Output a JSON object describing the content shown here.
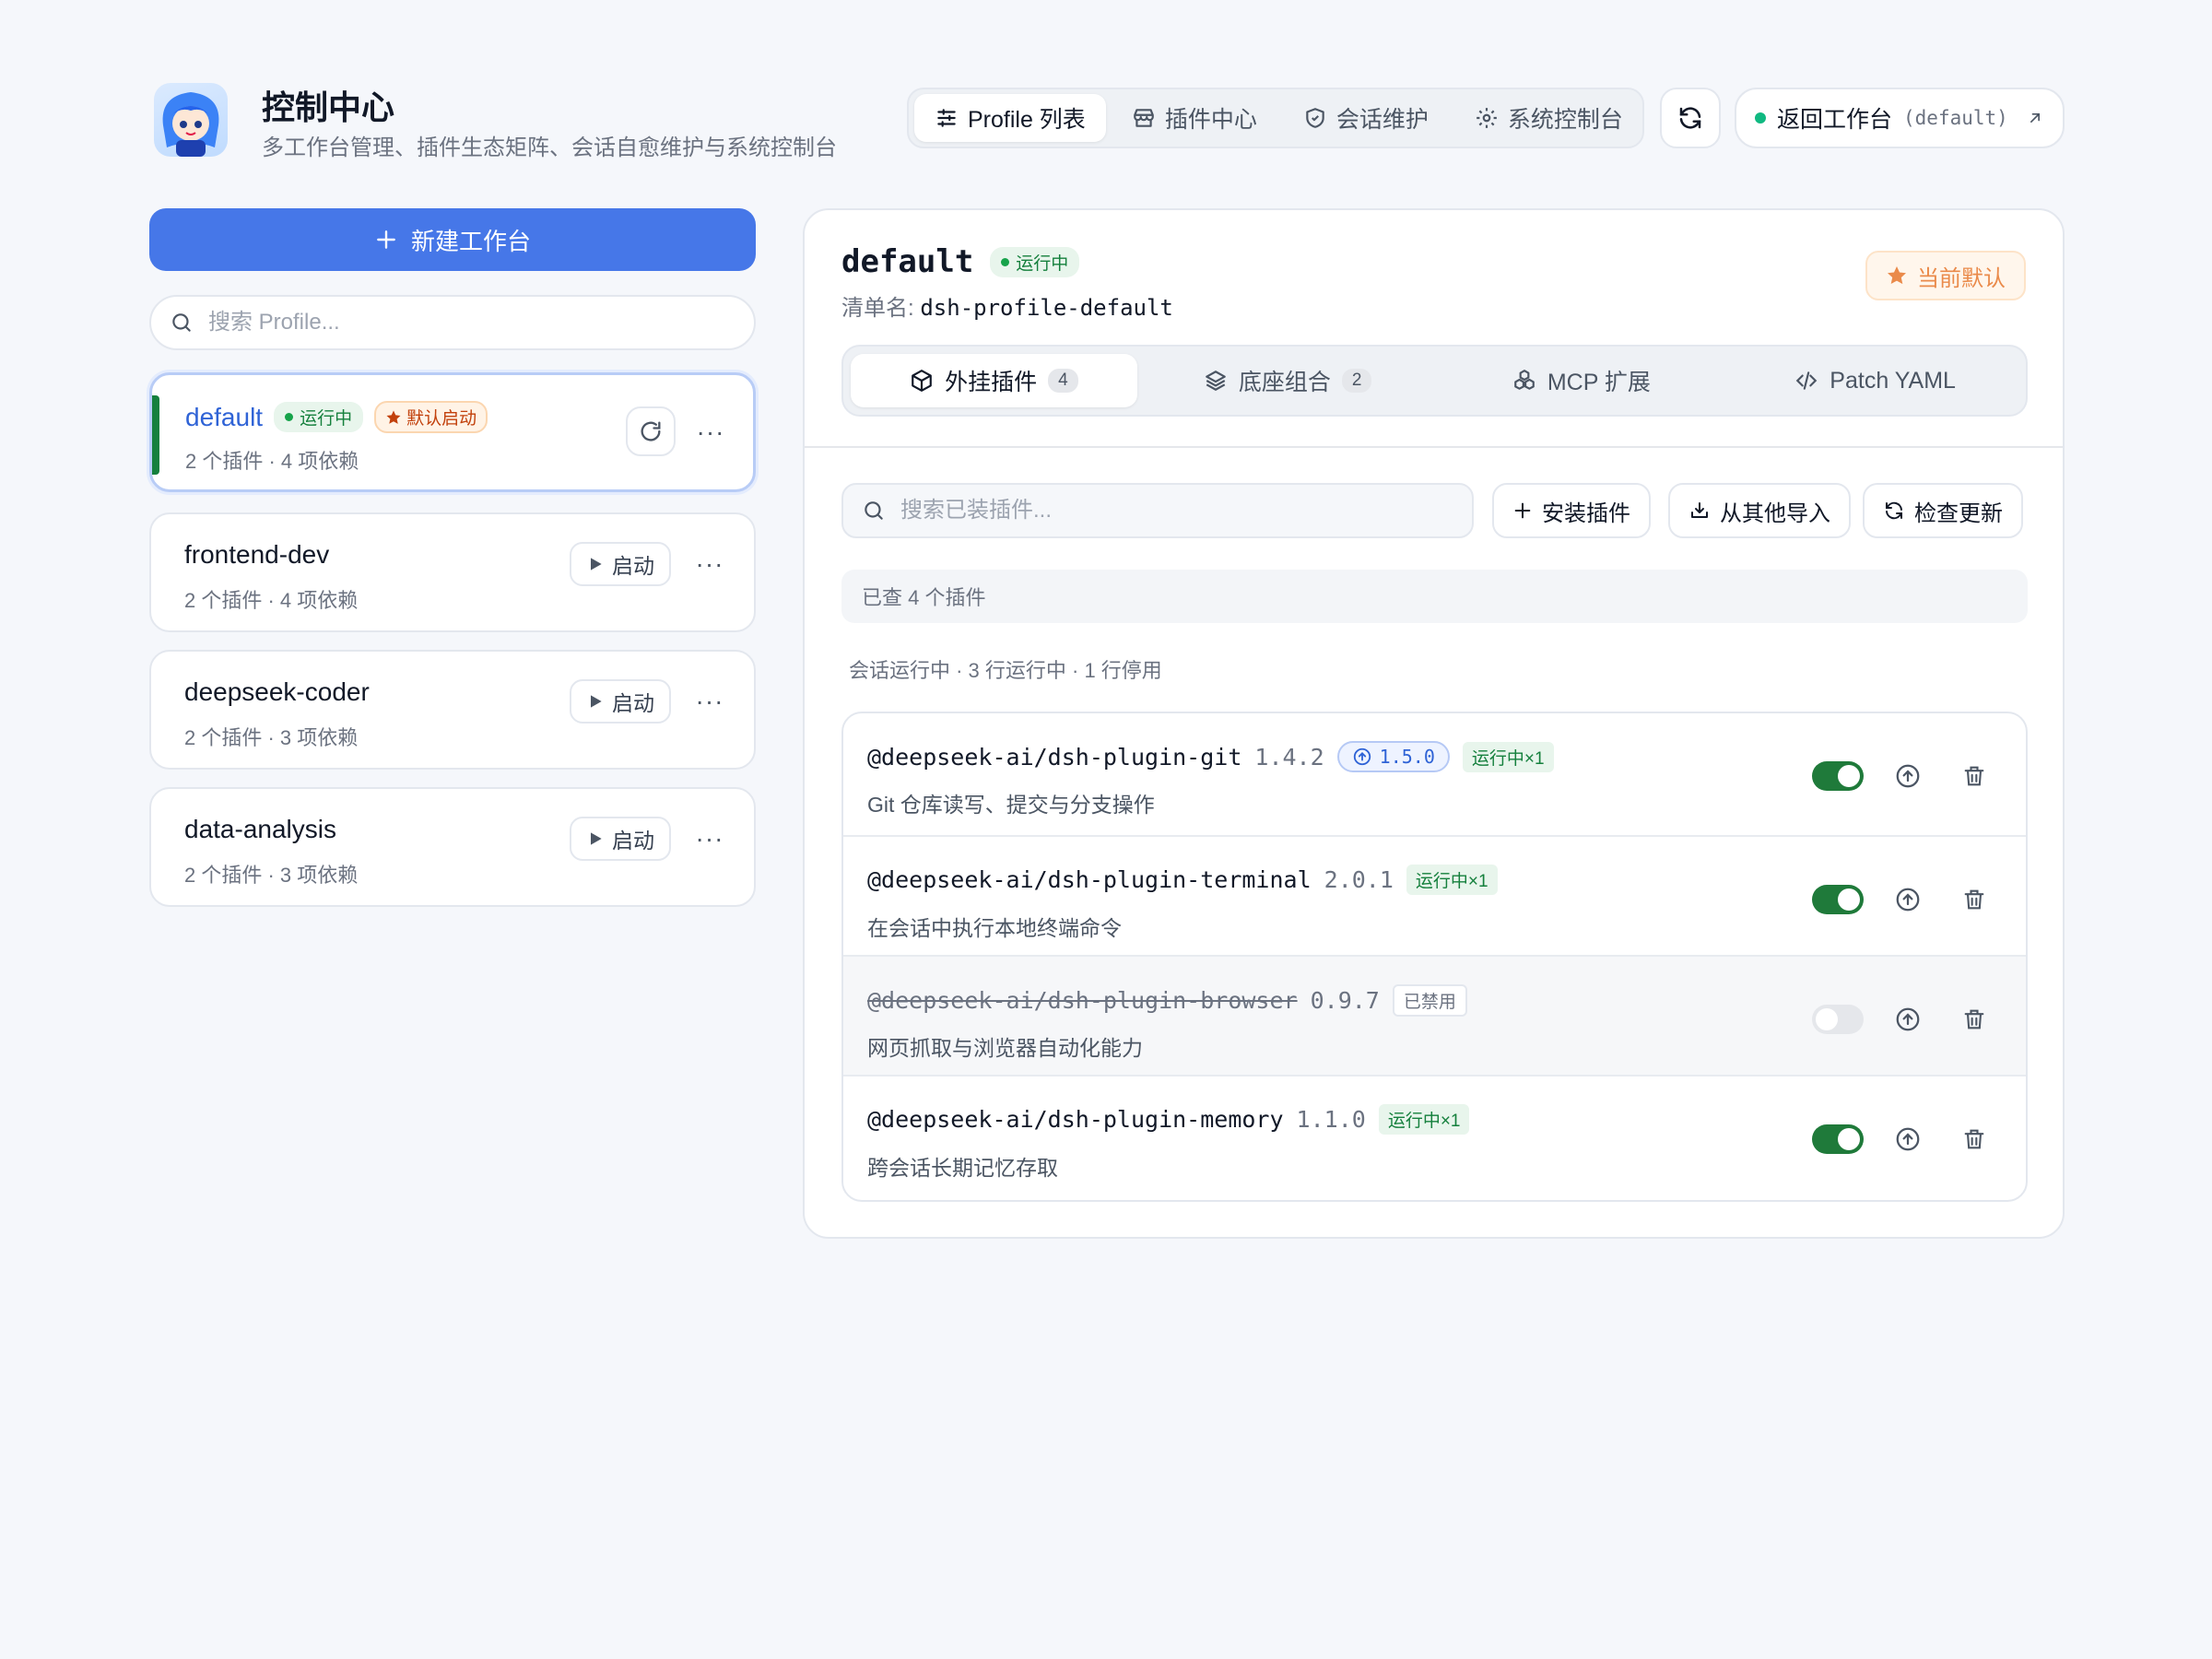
{
  "header": {
    "title": "控制中心",
    "subtitle": "多工作台管理、插件生态矩阵、会话自愈维护与系统控制台",
    "nav": [
      {
        "label": "Profile 列表",
        "icon": "sliders-icon"
      },
      {
        "label": "插件中心",
        "icon": "store-icon"
      },
      {
        "label": "会话维护",
        "icon": "shield-icon"
      },
      {
        "label": "系统控制台",
        "icon": "gear-icon"
      }
    ],
    "back_label": "返回工作台",
    "back_profile": "(default)"
  },
  "sidebar": {
    "new_button": "新建工作台",
    "search_placeholder": "搜索 Profile...",
    "profiles": [
      {
        "name": "default",
        "status": "运行中",
        "default_badge": "默认启动",
        "meta": "2 个插件 · 4 项依赖"
      },
      {
        "name": "frontend-dev",
        "meta": "2 个插件 · 4 项依赖",
        "start_label": "启动"
      },
      {
        "name": "deepseek-coder",
        "meta": "2 个插件 · 3 项依赖",
        "start_label": "启动"
      },
      {
        "name": "data-analysis",
        "meta": "2 个插件 · 3 项依赖",
        "start_label": "启动"
      }
    ]
  },
  "detail": {
    "name": "default",
    "status": "运行中",
    "manifest_label": "清单名:",
    "manifest_value": "dsh-profile-default",
    "current_default": "当前默认",
    "tabs": [
      {
        "label": "外挂插件",
        "count": "4"
      },
      {
        "label": "底座组合",
        "count": "2"
      },
      {
        "label": "MCP 扩展"
      },
      {
        "label": "Patch YAML"
      }
    ],
    "search_placeholder": "搜索已装插件...",
    "actions": {
      "install": "安装插件",
      "import": "从其他导入",
      "check": "检查更新"
    },
    "found_text": "已查 4 个插件",
    "summary": "会话运行中 · 3 行运行中 · 1 行停用",
    "plugins": [
      {
        "name": "@deepseek-ai/dsh-plugin-git",
        "version": "1.4.2",
        "update": "1.5.0",
        "badge": "运行中×1",
        "desc": "Git 仓库读写、提交与分支操作",
        "enabled": true
      },
      {
        "name": "@deepseek-ai/dsh-plugin-terminal",
        "version": "2.0.1",
        "badge": "运行中×1",
        "desc": "在会话中执行本地终端命令",
        "enabled": true
      },
      {
        "name": "@deepseek-ai/dsh-plugin-browser",
        "version": "0.9.7",
        "badge": "已禁用",
        "desc": "网页抓取与浏览器自动化能力",
        "enabled": false
      },
      {
        "name": "@deepseek-ai/dsh-plugin-memory",
        "version": "1.1.0",
        "badge": "运行中×1",
        "desc": "跨会话长期记忆存取",
        "enabled": true
      }
    ]
  },
  "colors": {
    "accent": "#4677e8",
    "running": "#15803d",
    "toggle_on": "#1f7a3a",
    "default_orange": "#ea8a4a"
  }
}
